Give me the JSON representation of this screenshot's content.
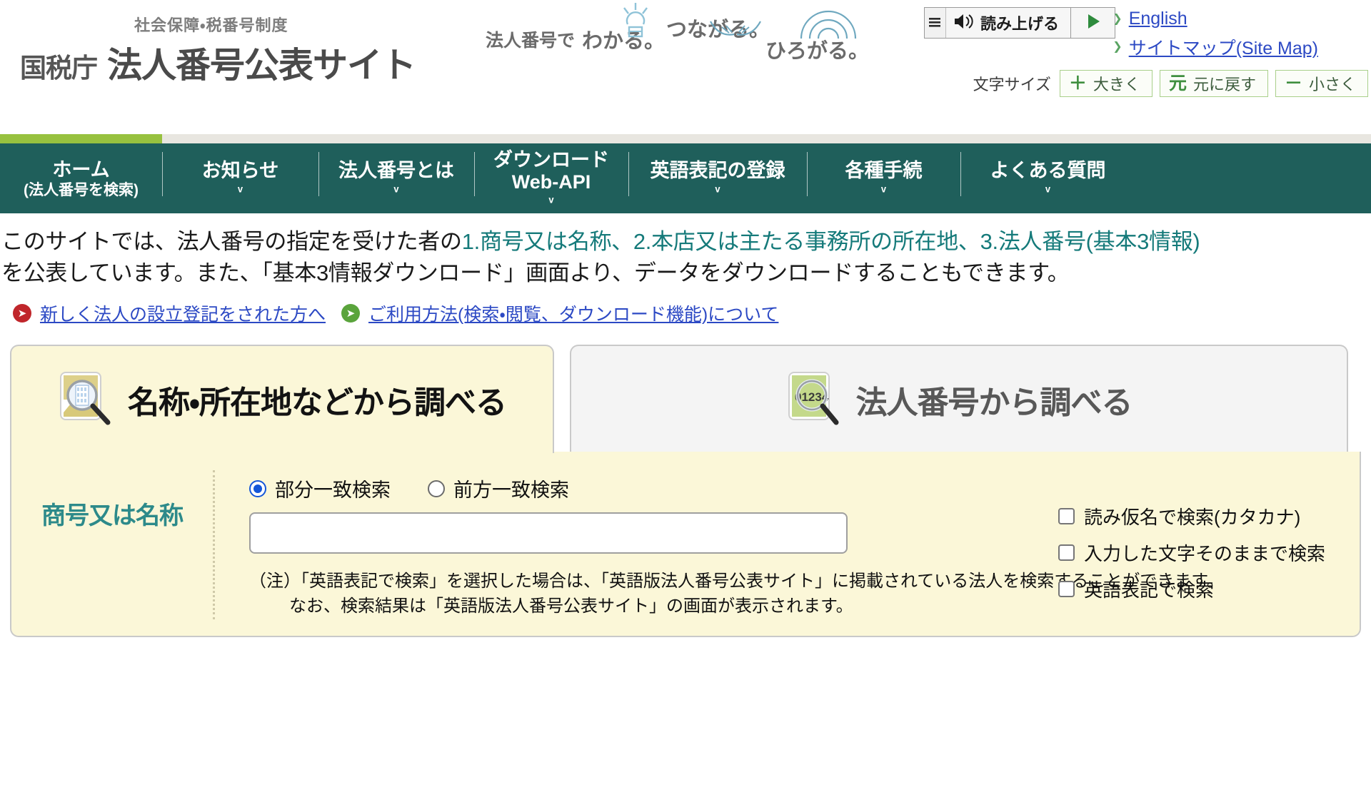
{
  "header": {
    "brand_sub": "社会保障・税番号制度",
    "brand_agency": "国税庁",
    "brand_title": "法人番号公表サイト",
    "tagline_lead": "法人番号で",
    "tagline_w1": "わかる。",
    "tagline_w2": "つながる。",
    "tagline_w3": "ひろがる。",
    "speak_label": "読み上げる",
    "links": [
      {
        "label": "English"
      },
      {
        "label": "サイトマップ(Site Map)"
      }
    ],
    "fontsize_label": "文字サイズ",
    "fontsize_buttons": [
      {
        "sign": "＋",
        "label": "大きく"
      },
      {
        "sign": "元",
        "label": "元に戻す"
      },
      {
        "sign": "－",
        "label": "小さく"
      }
    ]
  },
  "nav": {
    "items": [
      {
        "line1": "ホーム",
        "line2": "(法人番号を検索)",
        "caret": "",
        "active": true
      },
      {
        "line1": "お知らせ",
        "line2": "",
        "caret": "ᵛ",
        "active": false
      },
      {
        "line1": "法人番号とは",
        "line2": "",
        "caret": "ᵛ",
        "active": false
      },
      {
        "line1": "ダウンロード",
        "line2": "Web-API",
        "caret": "ᵛ",
        "active": false
      },
      {
        "line1": "英語表記の登録",
        "line2": "",
        "caret": "ᵛ",
        "active": false
      },
      {
        "line1": "各種手続",
        "line2": "",
        "caret": "ᵛ",
        "active": false
      },
      {
        "line1": "よくある質問",
        "line2": "",
        "caret": "ᵛ",
        "active": false
      }
    ]
  },
  "intro": {
    "line1_a": "このサイトでは、法人番号の指定を受けた者の",
    "line1_hl": "1.商号又は名称、2.本店又は主たる事務所の所在地、3.法人番号(基本3情報)",
    "line2": "を公表しています。また、「基本3情報ダウンロード」画面より、データをダウンロードすることもできます。",
    "links": [
      {
        "label": "新しく法人の設立登記をされた方へ",
        "dot": "red"
      },
      {
        "label": "ご利用方法(検索・閲覧、ダウンロード機能)について",
        "dot": "green"
      }
    ]
  },
  "tabs": [
    {
      "label": "名称・所在地などから調べる",
      "icon": "building-magnifier-icon",
      "active": true
    },
    {
      "label": "法人番号から調べる",
      "icon": "number-magnifier-icon",
      "active": false
    }
  ],
  "search_form": {
    "field_label": "商号又は名称",
    "match_options": [
      {
        "label": "部分一致検索",
        "selected": true
      },
      {
        "label": "前方一致検索",
        "selected": false
      }
    ],
    "text_input_value": "",
    "text_input_placeholder": "",
    "checkboxes": [
      {
        "label": "読み仮名で検索(カタカナ)",
        "checked": false
      },
      {
        "label": "入力した文字そのままで検索",
        "checked": false
      },
      {
        "label": "英語表記で検索",
        "checked": false
      }
    ],
    "note_line1": "（注）「英語表記で検索」を選択した場合は、「英語版法人番号公表サイト」に掲載されている法人を検索することができます。",
    "note_line2": "なお、検索結果は「英語版法人番号公表サイト」の画面が表示されます。"
  },
  "colors": {
    "nav_bg": "#1f5f5b",
    "accent_green": "#97c13f",
    "panel_bg": "#fbf7d8",
    "link_blue": "#2c49c4",
    "teal_text": "#157a7a"
  }
}
